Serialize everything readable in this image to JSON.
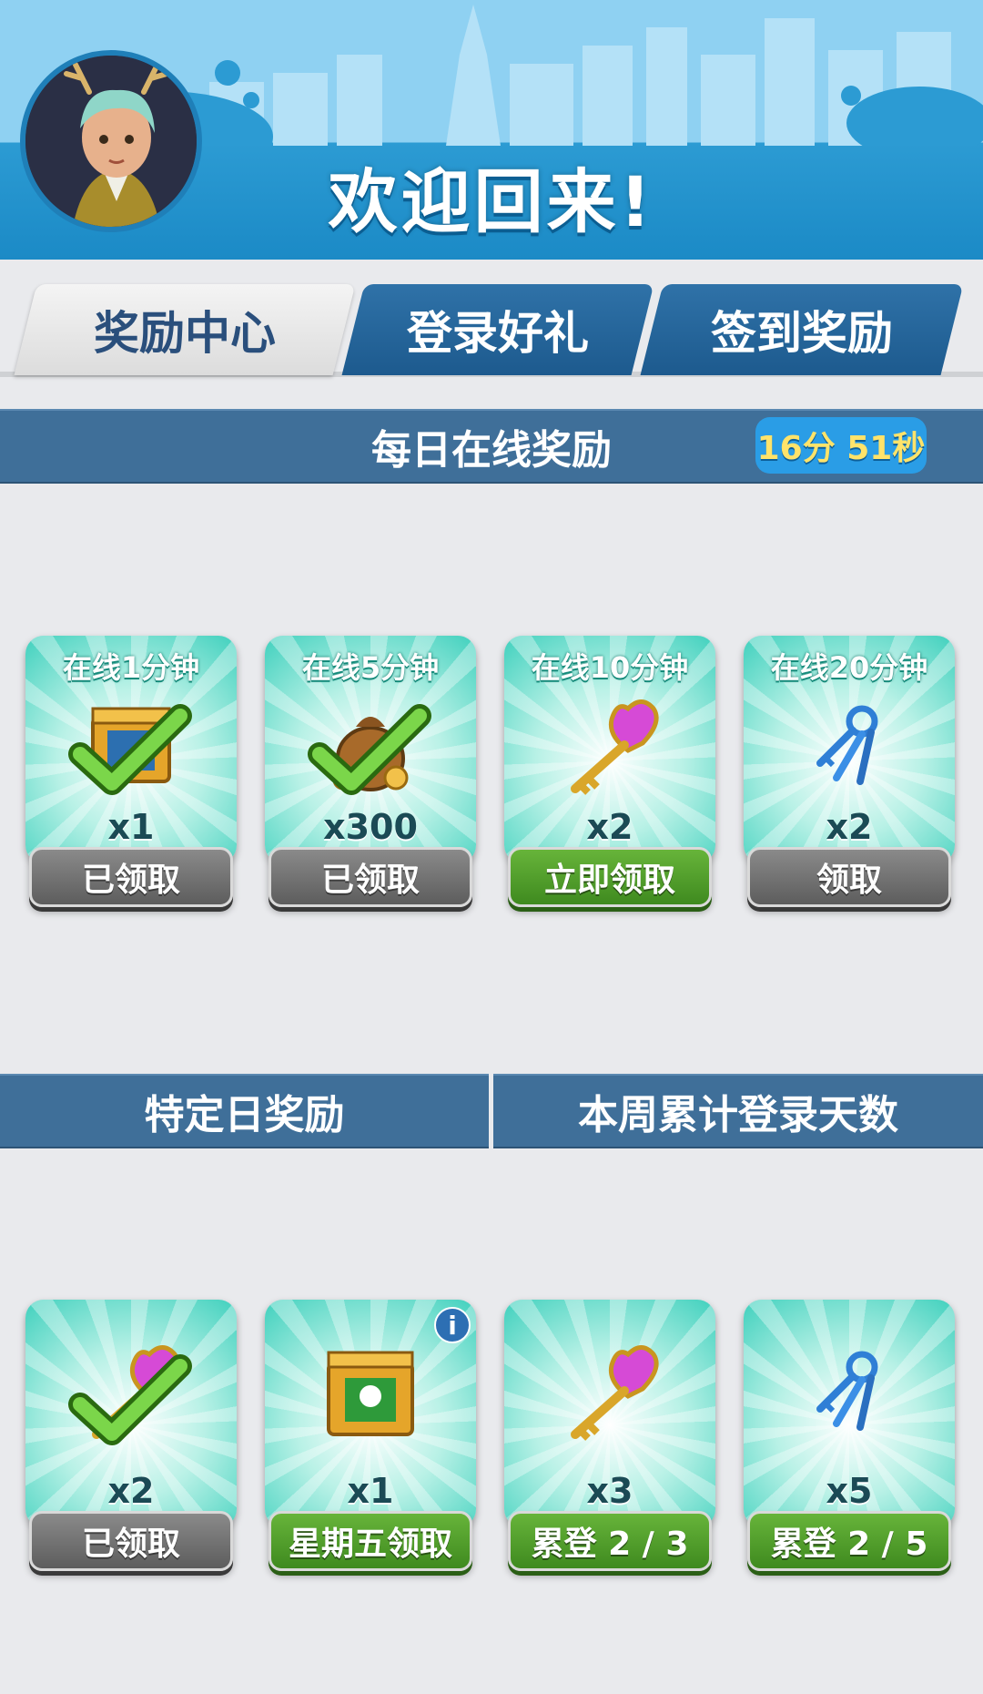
{
  "header": {
    "title": "欢迎回来!"
  },
  "tabs": [
    {
      "label": "奖励中心",
      "active": true
    },
    {
      "label": "登录好礼",
      "active": false
    },
    {
      "label": "签到奖励",
      "active": false
    }
  ],
  "daily": {
    "title": "每日在线奖励",
    "timer": "16分 51秒",
    "cards": [
      {
        "title": "在线1分钟",
        "icon": "mystery-box-icon",
        "qty": "x1",
        "button": "已领取",
        "state": "claimed"
      },
      {
        "title": "在线5分钟",
        "icon": "coin-bag-icon",
        "qty": "x300",
        "button": "已领取",
        "state": "claimed"
      },
      {
        "title": "在线10分钟",
        "icon": "heart-key-icon",
        "qty": "x2",
        "button": "立即领取",
        "state": "available"
      },
      {
        "title": "在线20分钟",
        "icon": "keys-icon",
        "qty": "x2",
        "button": "领取",
        "state": "locked"
      }
    ]
  },
  "special": {
    "title_left": "特定日奖励",
    "title_right": "本周累计登录天数",
    "cards": [
      {
        "icon": "heart-key-icon",
        "qty": "x2",
        "button": "已领取",
        "state": "claimed"
      },
      {
        "icon": "mystery-box-icon",
        "qty": "x1",
        "button": "星期五领取",
        "state": "upcoming",
        "info": "i"
      },
      {
        "icon": "heart-key-icon",
        "qty": "x3",
        "button": "累登 2 / 3",
        "state": "progress"
      },
      {
        "icon": "keys-icon",
        "qty": "x5",
        "button": "累登 2 / 5",
        "state": "progress"
      }
    ]
  },
  "colors": {
    "accent": "#3f6f99",
    "button_claimed": "#6b6b6b",
    "button_green": "#4f9a2a",
    "timer_bg": "#2a9de6",
    "timer_text": "#ffe36a"
  }
}
